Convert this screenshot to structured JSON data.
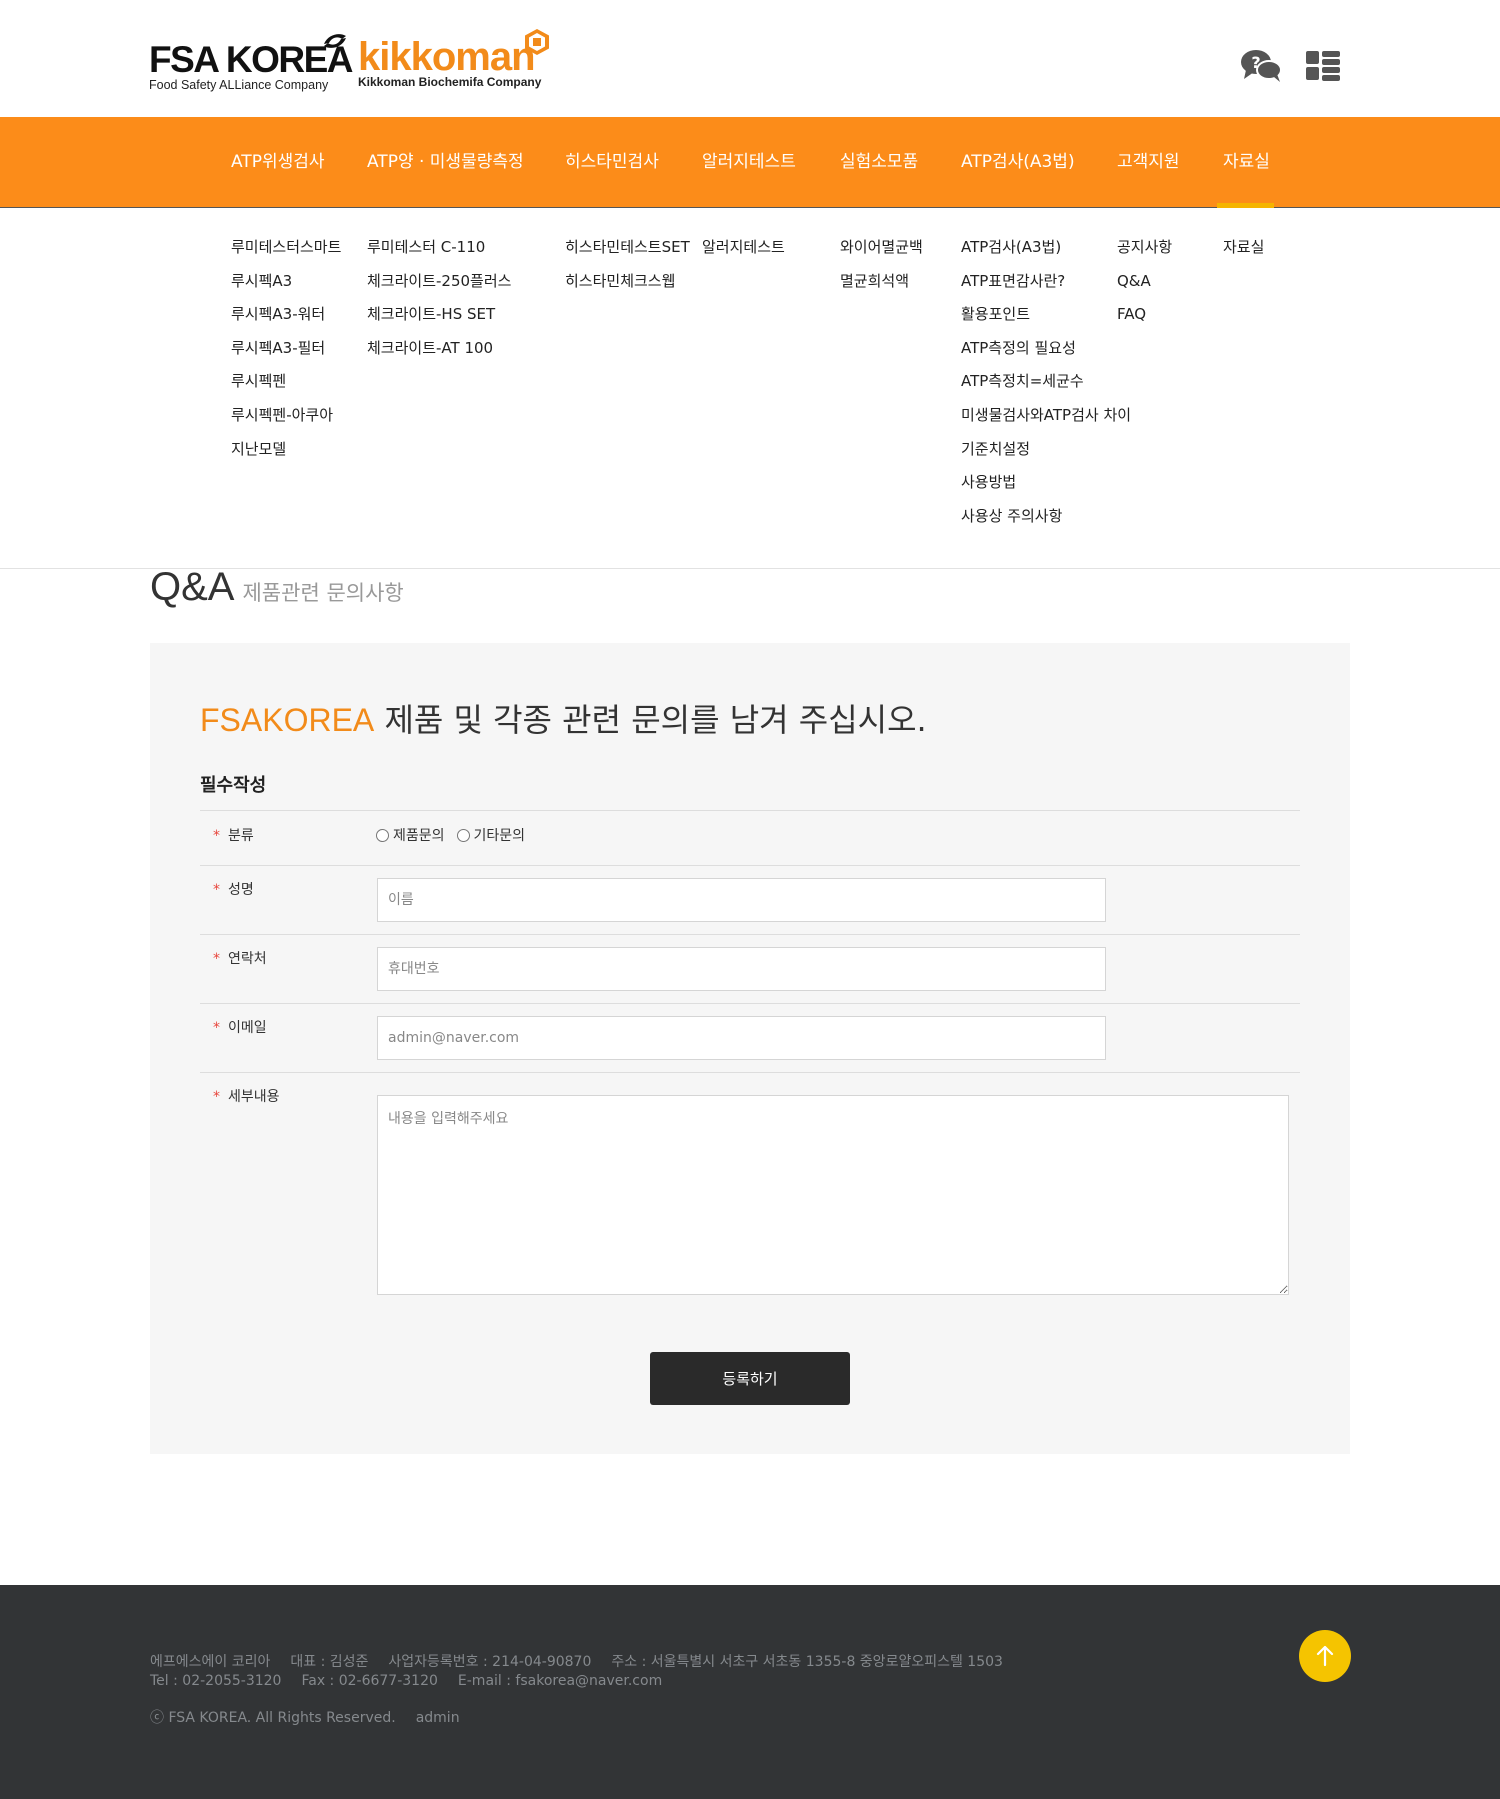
{
  "header": {
    "logo_fsa_main": "FSA KOREA",
    "logo_fsa_sub": "Food Safety ALLiance Company",
    "logo_kik_main": "kikkoman",
    "logo_kik_sub": "Kikkoman Biochemifa Company",
    "icons": [
      "qa-chat-icon",
      "grid-menu-icon"
    ]
  },
  "nav": {
    "items": [
      {
        "label": "ATP위생검사"
      },
      {
        "label": "ATP양 · 미생물량측정"
      },
      {
        "label": "히스타민검사"
      },
      {
        "label": "알러지테스트"
      },
      {
        "label": "실험소모품"
      },
      {
        "label": "ATP검사(A3법)"
      },
      {
        "label": "고객지원"
      },
      {
        "label": "자료실"
      }
    ],
    "active_index": 7,
    "bg_color": "#fc8c19",
    "active_bar_color": "#f5b400"
  },
  "mega_menu": {
    "columns": [
      [
        "루미테스터스마트",
        "루시펙A3",
        "루시펙A3-워터",
        "루시펙A3-필터",
        "루시펙펜",
        "루시펙펜-아쿠아",
        "지난모델"
      ],
      [
        "루미테스터 C-110",
        "체크라이트-250플러스",
        "체크라이트-HS SET",
        "체크라이트-AT 100"
      ],
      [
        "히스타민테스트SET",
        "히스타민체크스웹"
      ],
      [
        "알러지테스트"
      ],
      [
        "와이어멸균백",
        "멸균희석액"
      ],
      [
        "ATP검사(A3법)",
        "ATP표면감사란?",
        "활용포인트",
        "ATP측정의 필요성",
        "ATP측정치=세균수",
        "미생물검사와ATP검사 차이",
        "기준치설정",
        "사용방법",
        "사용상 주의사항"
      ],
      [
        "공지사항",
        "Q&A",
        "FAQ"
      ],
      [
        "자료실"
      ]
    ]
  },
  "page": {
    "title": "Q&A",
    "subtitle": "제품관련 문의사항"
  },
  "form": {
    "headline_brand": "FSAKOREA",
    "headline_rest": " 제품 및 각종 관련 문의를 남겨 주십시오.",
    "section_title": "필수작성",
    "required_mark": "*",
    "category_label": "분류",
    "category_options": [
      "제품문의",
      "기타문의"
    ],
    "name_label": "성명",
    "name_placeholder": "이름",
    "phone_label": "연락처",
    "phone_placeholder": "휴대번호",
    "email_label": "이메일",
    "email_placeholder": "admin@naver.com",
    "detail_label": "세부내용",
    "detail_placeholder": "내용을 입력해주세요",
    "submit_label": "등록하기",
    "accent_color": "#f28b1a",
    "required_color": "#e8453c"
  },
  "footer": {
    "company": "에프에스에이 코리아",
    "ceo": "대표 : 김성준",
    "biz_no": "사업자등록번호 : 214-04-90870",
    "address": "주소 : 서울특별시 서초구 서초동 1355-8 중앙로얄오피스텔 1503",
    "tel": "Tel : 02-2055-3120",
    "fax": "Fax : 02-6677-3120",
    "email": "E-mail : fsakorea@naver.com",
    "copyright": "ⓒ FSA KOREA. All Rights Reserved.",
    "admin": "admin",
    "top_button_color": "#f5c400"
  }
}
